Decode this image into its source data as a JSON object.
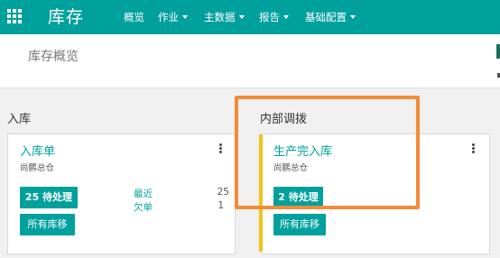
{
  "app": {
    "icons": {
      "apps": "apps-grid-icon",
      "caret": "caret-down-icon",
      "kebab": "kebab-vertical-icon"
    },
    "name": "库存",
    "colors": {
      "brand": "#00A09D",
      "highlight": "#F28C38",
      "accent_bar": "#F0C419"
    }
  },
  "nav": {
    "overview": "概览",
    "operations": "作业",
    "master_data": "主数据",
    "reports": "报告",
    "configuration": "基础配置"
  },
  "breadcrumb": "库存概览",
  "columns": {
    "receipts": "入库",
    "internal": "内部调拨"
  },
  "cards": {
    "receipts": {
      "title": "入库单",
      "warehouse": "尚鹏总仓",
      "todo_button": "25 待处理",
      "all_moves_button": "所有库移",
      "late_label": "最近",
      "late_count": "25",
      "backorder_label": "欠单",
      "backorder_count": "1"
    },
    "production": {
      "title": "生产完入库",
      "warehouse": "尚鹏总仓",
      "todo_button": "2 待处理",
      "all_moves_button": "所有库移"
    }
  }
}
